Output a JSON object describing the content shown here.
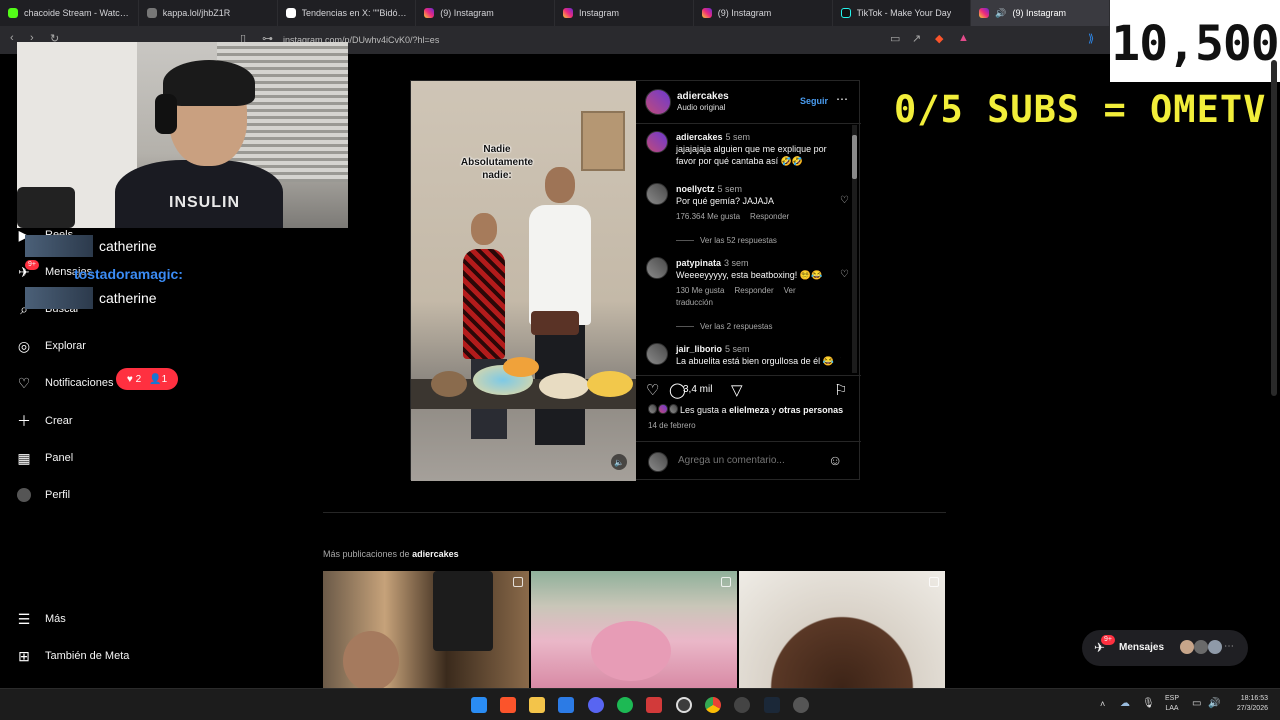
{
  "browser": {
    "tabs": [
      {
        "title": "chacoide Stream - Watch L",
        "icon": "twitch"
      },
      {
        "title": "kappa.lol/jhbZ1R",
        "icon": "kappa"
      },
      {
        "title": "Tendencias en X: \"\"Bidón\"\": Por",
        "icon": "x"
      },
      {
        "title": "(9) Instagram",
        "icon": "instagram"
      },
      {
        "title": "Instagram",
        "icon": "instagram"
      },
      {
        "title": "(9) Instagram",
        "icon": "instagram"
      },
      {
        "title": "TikTok - Make Your Day",
        "icon": "tiktok"
      },
      {
        "title": "(9) Instagram",
        "icon": "instagram"
      }
    ],
    "url": "instagram.com/p/DUwhv4iCvK0/?hl=es"
  },
  "stream_overlay": {
    "counter": "10,500",
    "goal": "0/5 SUBS = OMETV",
    "webcam_shirt_text": "INSULIN",
    "chat": [
      {
        "name": "catherine"
      },
      {
        "user": "tostadoramagic:",
        "badge": "9+"
      },
      {
        "name": "catherine"
      }
    ]
  },
  "sidebar": {
    "items": [
      {
        "label": "Reels",
        "icon": "reels-icon"
      },
      {
        "label": "Mensajes",
        "icon": "messenger-icon"
      },
      {
        "label": "Buscar",
        "icon": "search-icon"
      },
      {
        "label": "Explorar",
        "icon": "compass-icon"
      },
      {
        "label": "Notificaciones",
        "icon": "heart-icon"
      },
      {
        "label": "Crear",
        "icon": "plus-icon"
      },
      {
        "label": "Panel",
        "icon": "chart-icon"
      },
      {
        "label": "Perfil",
        "icon": "avatar"
      }
    ],
    "notif_badge": {
      "likes": "2",
      "follows": "1"
    },
    "bottom": [
      {
        "label": "Más",
        "icon": "menu-icon"
      },
      {
        "label": "También de Meta",
        "icon": "meta-icon"
      }
    ]
  },
  "post": {
    "video_overlay_line1": "Nadie",
    "video_overlay_line2": "Absolutamente nadie:",
    "author": "adiercakes",
    "audio": "Audio original",
    "follow_label": "Seguir",
    "comments": [
      {
        "user": "adiercakes",
        "time": "5 sem",
        "text": "jajajajaja alguien que me explique por favor por qué cantaba así 🤣🤣",
        "likes": "",
        "reply": "",
        "translate": ""
      },
      {
        "user": "noellyctz",
        "time": "5 sem",
        "text": "Por qué gemía? JAJAJA",
        "likes": "176.364 Me gusta",
        "reply": "Responder",
        "translate": "",
        "replies": "Ver las 52 respuestas"
      },
      {
        "user": "patypinata",
        "time": "3 sem",
        "text": "Weeeeyyyyy, esta beatboxing! 😵‍💫😂",
        "likes": "130 Me gusta",
        "reply": "Responder",
        "translate": "Ver traducción",
        "replies": "Ver las 2 respuestas"
      },
      {
        "user": "jair_liborio",
        "time": "5 sem",
        "text": "La abuelita está bien orgullosa de él 😂",
        "likes": "",
        "reply": "",
        "translate": ""
      }
    ],
    "comment_count": "3,4 mil",
    "likes_prefix": "Les gusta a",
    "likes_user": "elielmeza",
    "likes_and": "y",
    "likes_others": "otras personas",
    "date": "14 de febrero",
    "comment_placeholder": "Agrega un comentario..."
  },
  "more": {
    "prefix": "Más publicaciones de",
    "author": "adiercakes"
  },
  "messages": {
    "label": "Mensajes",
    "badge": "9+"
  },
  "taskbar": {
    "lang1": "ESP",
    "lang2": "LAA",
    "time": "18:16:53",
    "date": "27/3/2026"
  }
}
